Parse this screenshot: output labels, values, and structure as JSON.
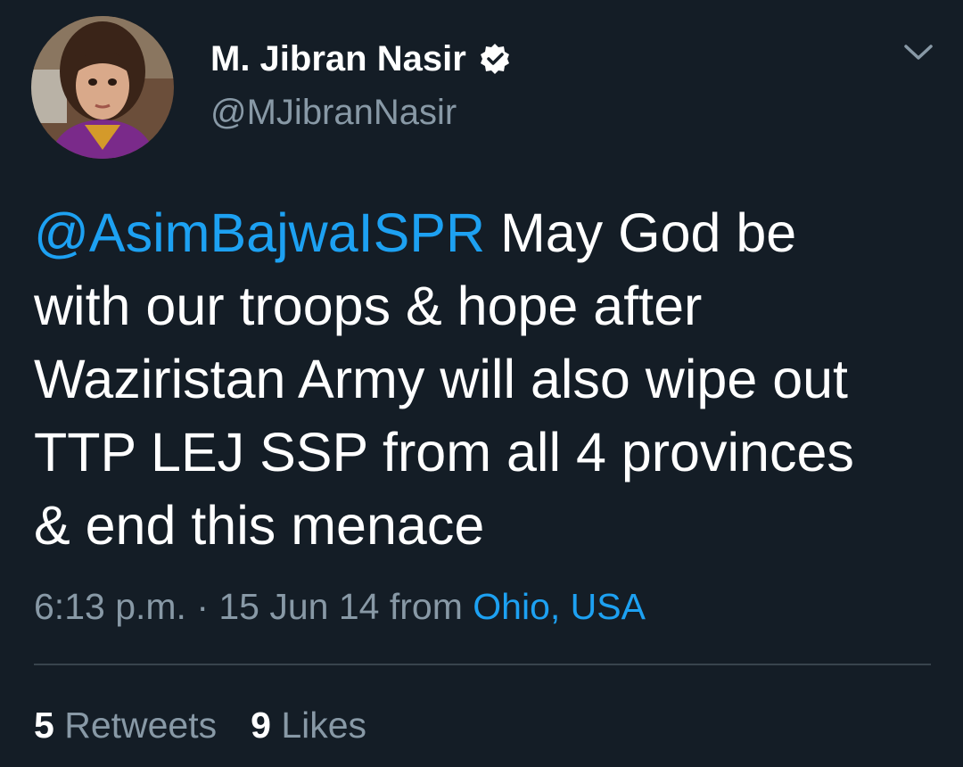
{
  "author": {
    "name": "M. Jibran Nasir",
    "handle": "@MJibranNasir",
    "verified_icon": "verified-badge-icon",
    "avatar_icon": "profile-photo"
  },
  "menu": {
    "icon": "chevron-down-icon"
  },
  "tweet": {
    "mention": "@AsimBajwaISPR",
    "line1_rest": " May God be",
    "line2": "with our troops & hope after",
    "line3": "Waziristan Army will also wipe out",
    "line4": "TTP LEJ SSP from all 4 provinces",
    "line5": "& end this menace"
  },
  "meta": {
    "time": "6:13 p.m.",
    "separator": " · ",
    "date": "15 Jun 14",
    "from_label": " from ",
    "location": "Ohio, USA"
  },
  "stats": {
    "retweets_count": "5",
    "retweets_label": " Retweets",
    "likes_count": "9",
    "likes_label": " Likes"
  },
  "colors": {
    "background": "#141d26",
    "link": "#1da1f2",
    "secondary_text": "#8899a6",
    "divider": "#38444d"
  }
}
